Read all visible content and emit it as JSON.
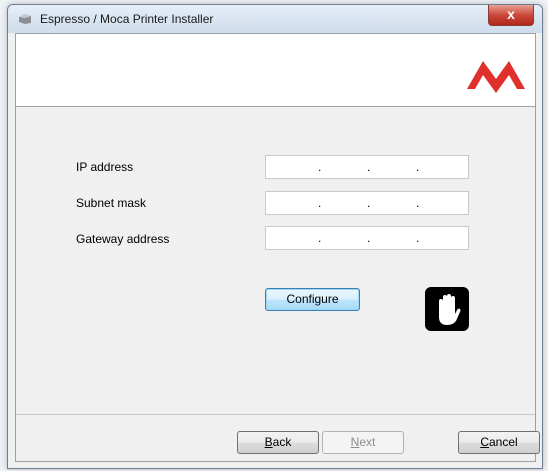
{
  "window": {
    "title": "Espresso / Moca Printer Installer",
    "close_label": "x"
  },
  "form": {
    "fields": [
      {
        "label": "IP address"
      },
      {
        "label": "Subnet mask"
      },
      {
        "label": "Gateway address"
      }
    ],
    "separator": "."
  },
  "buttons": {
    "configure": "Configure",
    "back_mnemonic": "B",
    "back_rest": "ack",
    "next_mnemonic": "N",
    "next_rest": "ext",
    "cancel_mnemonic": "C",
    "cancel_rest": "ancel"
  },
  "colors": {
    "brand_red": "#e0302b"
  }
}
